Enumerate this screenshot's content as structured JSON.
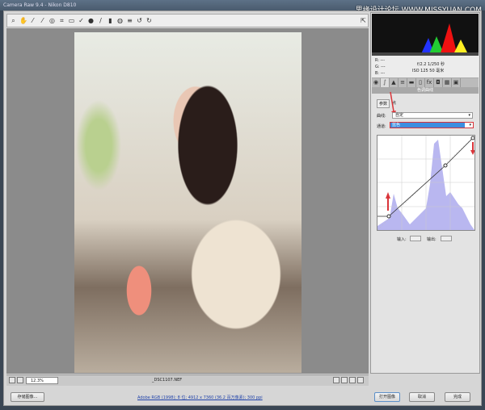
{
  "window": {
    "title": "Camera Raw 9.4 -  Nikon D810"
  },
  "watermark": "思缘设计论坛 WWW.MISSYUAN.COM",
  "toolbar": {
    "tools": [
      "zoom-icon",
      "hand-icon",
      "white-balance-icon",
      "color-sampler-icon",
      "targeted-adjustment-icon",
      "crop-icon",
      "straighten-icon",
      "spot-removal-icon",
      "red-eye-icon",
      "adjustment-brush-icon",
      "graduated-filter-icon",
      "radial-filter-icon",
      "preferences-icon",
      "rotate-ccw-icon",
      "rotate-cw-icon"
    ]
  },
  "info": {
    "r": "R:",
    "g": "G:",
    "b": "B:",
    "dash": "---",
    "aperture_shutter": "f/2.2   1/250 秒",
    "iso_focal": "ISO 125   50 毫米"
  },
  "panel": {
    "title": "色调曲线",
    "subtab_param": "参数",
    "subtab_point": "点",
    "curve_label": "曲线:",
    "curve_value": "自定",
    "channel_label": "通道:",
    "channel_value": "蓝色",
    "input_label": "输入:",
    "output_label": "输出:"
  },
  "imagebar": {
    "zoom": "12.3%",
    "filename": "_DSC1107.NEF"
  },
  "footer": {
    "save": "存储图像...",
    "workflow_link": "Adobe RGB (1998); 8 位; 4912 x 7360 (36.2 百万像素); 300 ppi",
    "open": "打开图像",
    "cancel": "取消",
    "done": "完成"
  },
  "colors": {
    "accent": "#3d8ee0",
    "arrow": "#d9353a",
    "histogram_fill": "#b9b7f0"
  }
}
